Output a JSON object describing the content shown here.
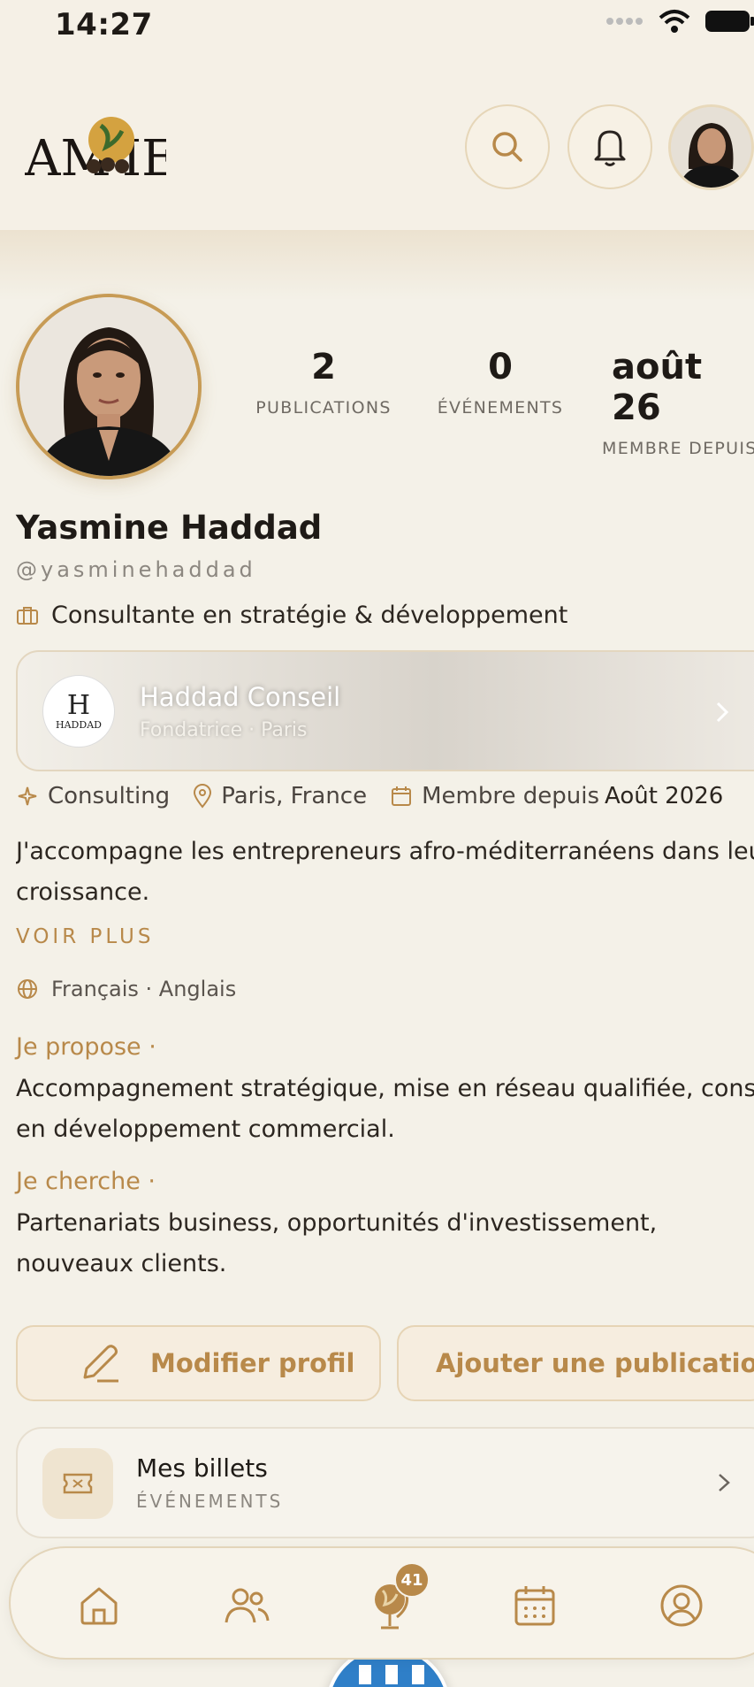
{
  "status_bar": {
    "time": "14:27"
  },
  "header": {
    "logo_text": "AMIE"
  },
  "profile": {
    "stats": [
      {
        "value": "2",
        "label": "PUBLICATIONS"
      },
      {
        "value": "0",
        "label": "ÉVÉNEMENTS"
      },
      {
        "value": "août 26",
        "label": "MEMBRE DEPUIS"
      }
    ],
    "name": "Yasmine Haddad",
    "handle": "@yasminehaddad",
    "role": "Consultante en stratégie & développement",
    "company": {
      "logo_letter": "H",
      "logo_text": "HADDAD",
      "name": "Haddad Conseil",
      "subtitle": "Fondatrice · Paris"
    },
    "meta": {
      "industry": "Consulting",
      "location": "Paris, France",
      "member_label": "Membre depuis",
      "member_date": "Août 2026"
    },
    "bio_line1": "J'accompagne les entrepreneurs afro-méditerranéens dans leur",
    "bio_line2": "croissance.",
    "see_more": "VOIR PLUS",
    "languages": "Français · Anglais",
    "offer_title": "Je propose ·",
    "offer_line1": "Accompagnement stratégique, mise en réseau qualifiée, conseil",
    "offer_line2": "en développement commercial.",
    "seek_title": "Je cherche ·",
    "seek_line1": "Partenariats business, opportunités d'investissement,",
    "seek_line2": "nouveaux clients."
  },
  "actions": {
    "edit_label": "Modifier profil",
    "add_label": "Ajouter une publication"
  },
  "tickets": {
    "title": "Mes billets",
    "subtitle": "ÉVÉNEMENTS"
  },
  "nav": {
    "badge_count": "41"
  },
  "colors": {
    "accent": "#b8894a",
    "background": "#f4f1e8",
    "blue": "#2f7fc8"
  }
}
